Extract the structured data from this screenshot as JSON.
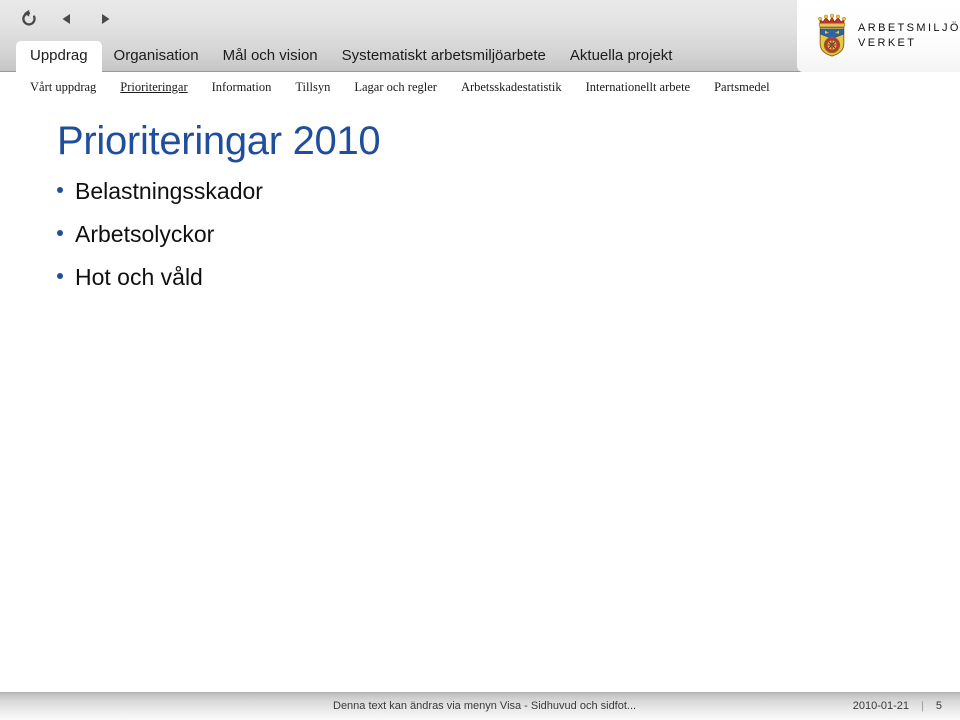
{
  "header": {
    "nav_controls": [
      {
        "name": "reload-icon",
        "label": "Reload"
      },
      {
        "name": "back-icon",
        "label": "Back"
      },
      {
        "name": "forward-icon",
        "label": "Forward"
      }
    ],
    "tabs": [
      {
        "label": "Uppdrag",
        "active": true
      },
      {
        "label": "Organisation",
        "active": false
      },
      {
        "label": "Mål och vision",
        "active": false
      },
      {
        "label": "Systematiskt arbetsmiljöarbete",
        "active": false
      },
      {
        "label": "Aktuella projekt",
        "active": false
      }
    ],
    "logo": {
      "line1": "ARBETSMILJÖ",
      "line2": "VERKET"
    }
  },
  "subnav": {
    "items": [
      {
        "label": "Vårt uppdrag",
        "active": false
      },
      {
        "label": "Prioriteringar",
        "active": true
      },
      {
        "label": "Information",
        "active": false
      },
      {
        "label": "Tillsyn",
        "active": false
      },
      {
        "label": "Lagar och regler",
        "active": false
      },
      {
        "label": "Arbetsskadestatistik",
        "active": false
      },
      {
        "label": "Internationellt arbete",
        "active": false
      },
      {
        "label": "Partsmedel",
        "active": false
      }
    ]
  },
  "slide": {
    "title": "Prioriteringar 2010",
    "bullets": [
      "Belastningsskador",
      "Arbetsolyckor",
      "Hot och våld"
    ]
  },
  "footer": {
    "note": "Denna text kan ändras via menyn Visa - Sidhuvud och sidfot...",
    "date": "2010-01-21",
    "divider": "|",
    "page_number": "5"
  },
  "colors": {
    "title_blue": "#1f4e9c",
    "bullet_blue": "#1f4e9c",
    "header_gray": "#d8d8d8",
    "footer_gray": "#d8d8d8"
  }
}
